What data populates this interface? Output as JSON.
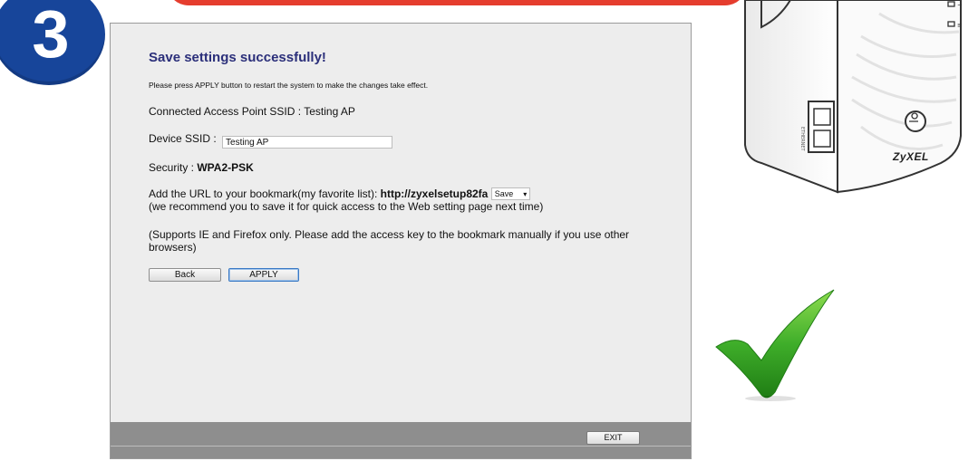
{
  "step": {
    "number": "3"
  },
  "setup": {
    "title": "Save settings successfully!",
    "note": "Please press APPLY button to restart the system to make the changes take effect.",
    "connected_ap_label": "Connected Access Point SSID : ",
    "connected_ap_value": "Testing AP",
    "device_ssid_label": "Device SSID : ",
    "device_ssid_value": "Testing AP",
    "security_label": "Security : ",
    "security_value": "WPA2-PSK",
    "bookmark_label": "Add the URL to your bookmark(my favorite list): ",
    "bookmark_url": "http://zyxelsetup82fa",
    "bookmark_select_value": "Save",
    "bookmark_hint": "(we recommend you to save it for quick access to the Web setting page next time)",
    "support_note": "(Supports IE and Firefox only. Please add the access key to the bookmark manually if you use other browsers)",
    "back_label": "Back",
    "apply_label": "APPLY",
    "exit_label": "EXIT"
  },
  "device": {
    "brand": "ZyXEL",
    "port_label": "ETHERNET"
  },
  "colors": {
    "badge": "#17459a",
    "banner": "#e53d2e",
    "title": "#2b2f7a",
    "footer": "#8e8e8e",
    "checkmark": "#3fae2a"
  },
  "icons": [
    "step-number-badge",
    "range-extender-device",
    "success-checkmark-icon",
    "dropdown-caret-icon"
  ]
}
